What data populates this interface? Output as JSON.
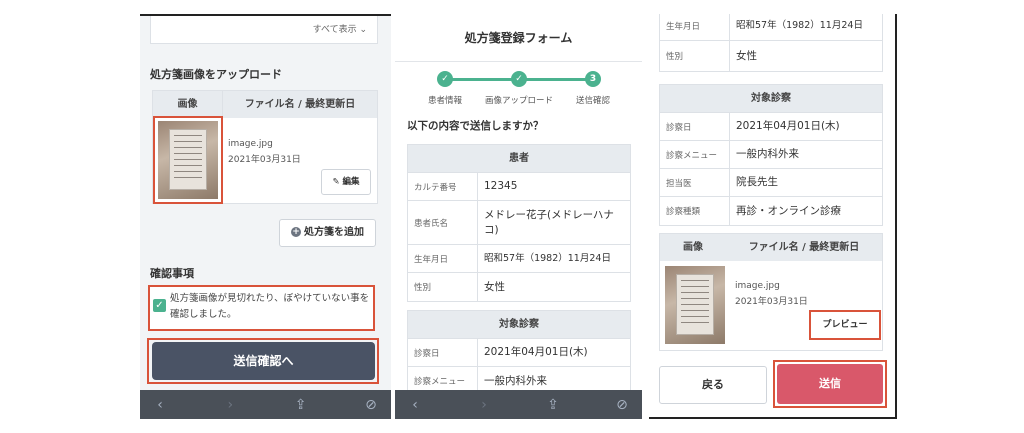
{
  "screen1": {
    "show_all": "すべて表示 ⌄",
    "upload_title": "処方箋画像をアップロード",
    "table": {
      "col_image": "画像",
      "col_file": "ファイル名 / 最終更新日"
    },
    "file": {
      "name": "image.jpg",
      "date": "2021年03月31日"
    },
    "edit_label": "✎ 編集",
    "add_label": "処方箋を追加",
    "confirm_title": "確認事項",
    "confirm_text": "処方箋画像が見切れたり、ぼやけていない事を確認しました。",
    "confirm_checked": true,
    "submit_label": "送信確認へ"
  },
  "screen2": {
    "title": "処方箋登録フォーム",
    "steps": [
      {
        "label": "患者情報",
        "marker": "✓"
      },
      {
        "label": "画像アップロード",
        "marker": "✓"
      },
      {
        "label": "送信確認",
        "marker": "3"
      }
    ],
    "question": "以下の内容で送信しますか？",
    "patient": {
      "heading": "患者",
      "rows": [
        {
          "k": "カルテ番号",
          "v": "12345"
        },
        {
          "k": "患者氏名",
          "v": "メドレー花子(メドレーハナコ)"
        },
        {
          "k": "生年月日",
          "v": "昭和57年（1982）11月24日"
        },
        {
          "k": "性別",
          "v": "女性"
        }
      ]
    },
    "exam": {
      "heading": "対象診察",
      "rows": [
        {
          "k": "診察日",
          "v": "2021年04月01日(木)"
        },
        {
          "k": "診察メニュー",
          "v": "一般内科外来"
        }
      ]
    }
  },
  "screen3": {
    "top_rows": [
      {
        "k": "生年月日",
        "v": "昭和57年（1982）11月24日"
      },
      {
        "k": "性別",
        "v": "女性"
      }
    ],
    "exam": {
      "heading": "対象診察",
      "rows": [
        {
          "k": "診察日",
          "v": "2021年04月01日(木)"
        },
        {
          "k": "診察メニュー",
          "v": "一般内科外来"
        },
        {
          "k": "担当医",
          "v": "院長先生"
        },
        {
          "k": "診察種類",
          "v": "再診・オンライン診療"
        }
      ]
    },
    "table": {
      "col_image": "画像",
      "col_file": "ファイル名 / 最終更新日"
    },
    "file": {
      "name": "image.jpg",
      "date": "2021年03月31日"
    },
    "preview_label": "プレビュー",
    "back_label": "戻る",
    "send_label": "送信"
  },
  "toolbar": {
    "icons": [
      "back-arrow-icon",
      "forward-arrow-icon",
      "share-icon",
      "compass-icon"
    ],
    "glyphs": [
      "‹",
      "›",
      "⇪",
      "⊘"
    ]
  },
  "colors": {
    "accent_green": "#4bb28f",
    "primary_dark": "#4a5365",
    "send_red": "#d9586a",
    "highlight_red": "#d9533a"
  }
}
